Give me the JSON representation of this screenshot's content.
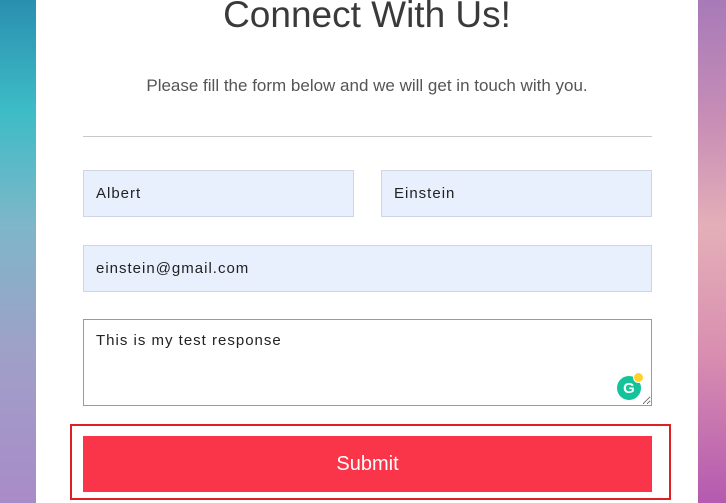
{
  "form": {
    "title": "Connect With Us!",
    "subtitle": "Please fill the form below and we will get in touch with you.",
    "first_name": "Albert",
    "last_name": "Einstein",
    "email": "einstein@gmail.com",
    "message": "This is my test response",
    "submit_label": "Submit"
  },
  "icons": {
    "grammarly": "grammarly-icon"
  },
  "colors": {
    "submit": "#fa3549",
    "field_bg": "#e8effd",
    "highlight": "#e02020"
  }
}
